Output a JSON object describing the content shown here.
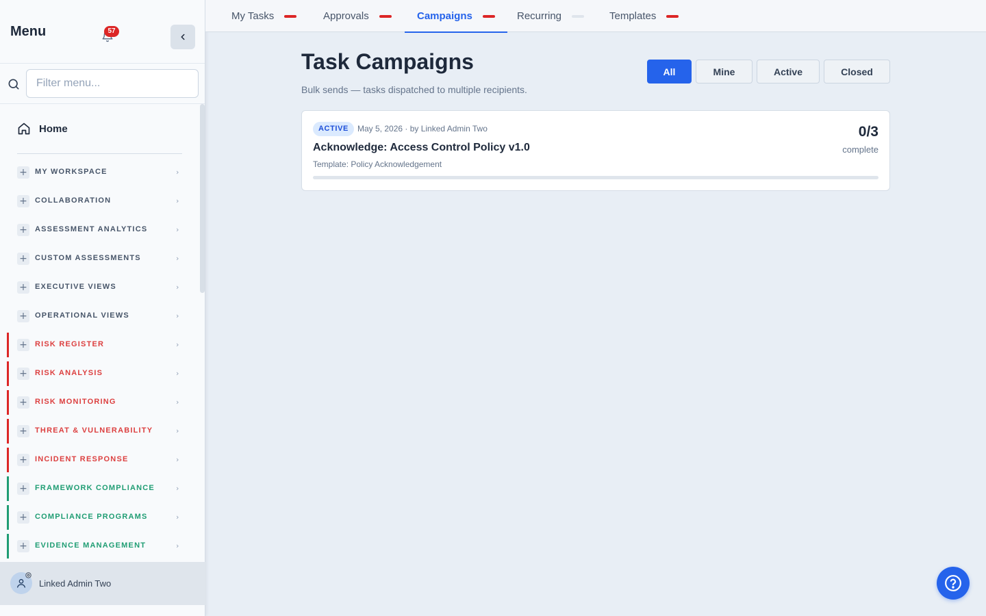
{
  "sidebar": {
    "title": "Menu",
    "notification_count": "57",
    "filter_placeholder": "Filter menu...",
    "home_label": "Home",
    "sections": [
      {
        "label": "MY WORKSPACE",
        "color": "#475569",
        "accent": ""
      },
      {
        "label": "COLLABORATION",
        "color": "#475569",
        "accent": ""
      },
      {
        "label": "ASSESSMENT ANALYTICS",
        "color": "#475569",
        "accent": ""
      },
      {
        "label": "CUSTOM ASSESSMENTS",
        "color": "#475569",
        "accent": ""
      },
      {
        "label": "EXECUTIVE VIEWS",
        "color": "#475569",
        "accent": ""
      },
      {
        "label": "OPERATIONAL VIEWS",
        "color": "#475569",
        "accent": ""
      },
      {
        "label": "RISK REGISTER",
        "color": "#dc3f3f",
        "accent": "#dc2626"
      },
      {
        "label": "RISK ANALYSIS",
        "color": "#dc3f3f",
        "accent": "#dc2626"
      },
      {
        "label": "RISK MONITORING",
        "color": "#dc3f3f",
        "accent": "#dc2626"
      },
      {
        "label": "THREAT & VULNERABILITY",
        "color": "#dc3f3f",
        "accent": "#dc2626"
      },
      {
        "label": "INCIDENT RESPONSE",
        "color": "#dc3f3f",
        "accent": "#dc2626"
      },
      {
        "label": "FRAMEWORK COMPLIANCE",
        "color": "#1f9d73",
        "accent": "#1f9d73"
      },
      {
        "label": "COMPLIANCE PROGRAMS",
        "color": "#1f9d73",
        "accent": "#1f9d73"
      },
      {
        "label": "EVIDENCE MANAGEMENT",
        "color": "#1f9d73",
        "accent": "#1f9d73"
      }
    ],
    "user_name": "Linked Admin Two"
  },
  "tabs": [
    {
      "label": "My Tasks",
      "indicator": "#dc2626",
      "active": false
    },
    {
      "label": "Approvals",
      "indicator": "#dc2626",
      "active": false
    },
    {
      "label": "Campaigns",
      "indicator": "#dc2626",
      "active": true
    },
    {
      "label": "Recurring",
      "indicator": "#dfe5ec",
      "active": false
    },
    {
      "label": "Templates",
      "indicator": "#dc2626",
      "active": false
    }
  ],
  "main": {
    "title": "Task Campaigns",
    "subtitle": "Bulk sends — tasks dispatched to multiple recipients.",
    "filters": [
      {
        "label": "All",
        "selected": true
      },
      {
        "label": "Mine",
        "selected": false
      },
      {
        "label": "Active",
        "selected": false
      },
      {
        "label": "Closed",
        "selected": false
      }
    ],
    "campaigns": [
      {
        "status": "ACTIVE",
        "meta": "May 5, 2026 · by Linked Admin Two",
        "title": "Acknowledge: Access Control Policy v1.0",
        "template": "Template: Policy Acknowledgement",
        "count": "0/3",
        "count_label": "complete",
        "progress": 0
      }
    ]
  },
  "colors": {
    "accent": "#2563eb",
    "danger": "#dc2626",
    "success": "#1f9d73"
  }
}
